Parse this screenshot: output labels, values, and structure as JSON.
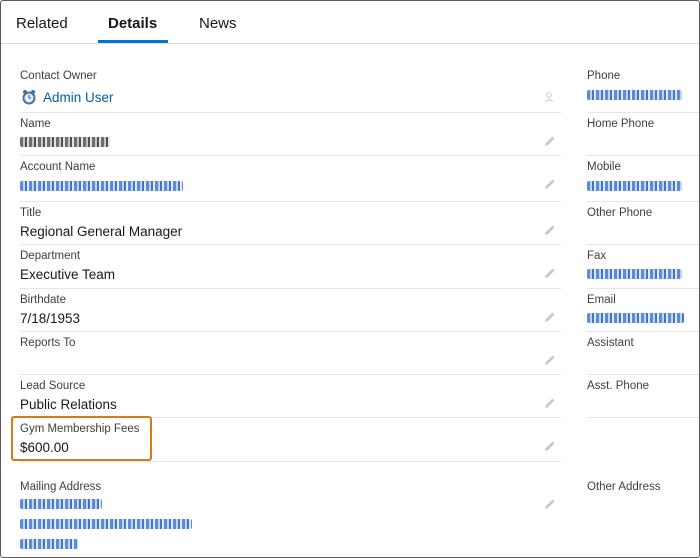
{
  "tabs": [
    {
      "label": "Related",
      "active": false
    },
    {
      "label": "Details",
      "active": true
    },
    {
      "label": "News",
      "active": false
    }
  ],
  "left_fields": {
    "contact_owner": {
      "label": "Contact Owner",
      "value": "Admin User"
    },
    "name": {
      "label": "Name"
    },
    "account_name": {
      "label": "Account Name"
    },
    "title": {
      "label": "Title",
      "value": "Regional General Manager"
    },
    "department": {
      "label": "Department",
      "value": "Executive Team"
    },
    "birthdate": {
      "label": "Birthdate",
      "value": "7/18/1953"
    },
    "reports_to": {
      "label": "Reports To",
      "value": ""
    },
    "lead_source": {
      "label": "Lead Source",
      "value": "Public Relations"
    },
    "gym_fees": {
      "label": "Gym Membership Fees",
      "value": "$600.00"
    },
    "mailing_address": {
      "label": "Mailing Address"
    }
  },
  "right_fields": {
    "phone": {
      "label": "Phone"
    },
    "home_phone": {
      "label": "Home Phone"
    },
    "mobile": {
      "label": "Mobile"
    },
    "other_phone": {
      "label": "Other Phone"
    },
    "fax": {
      "label": "Fax"
    },
    "email": {
      "label": "Email"
    },
    "assistant": {
      "label": "Assistant"
    },
    "asst_phone": {
      "label": "Asst. Phone"
    },
    "other_address": {
      "label": "Other Address"
    }
  },
  "icons": {
    "edit": "pencil-icon",
    "owner_avatar": "user-avatar-icon",
    "change_owner": "change-owner-icon"
  },
  "colors": {
    "link": "#0b5cab",
    "tab_active_underline": "#0176d3",
    "highlight_border": "#d97a17"
  }
}
